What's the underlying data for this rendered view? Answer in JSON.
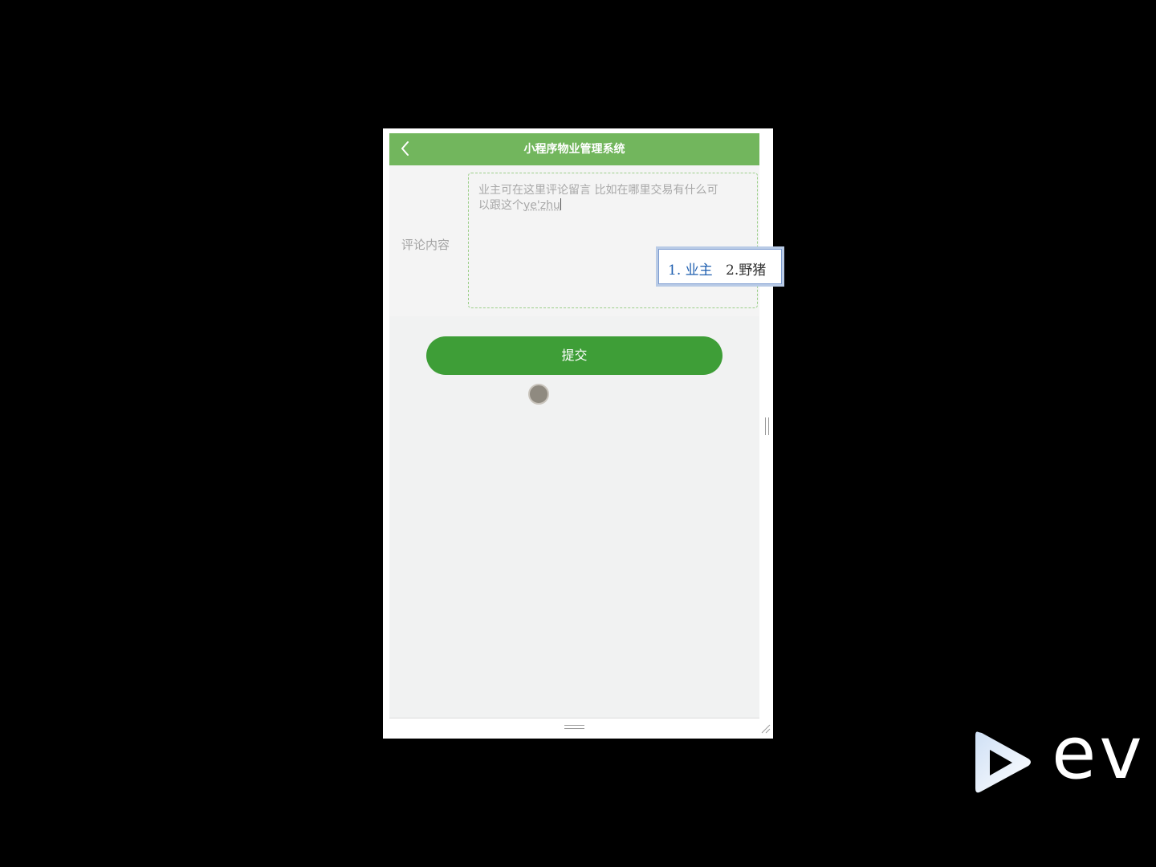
{
  "app": {
    "title": "小程序物业管理系统"
  },
  "form": {
    "label": "评论内容",
    "comment_text": "业主可在这里评论留言 比如在哪里交易有什么可以跟这个",
    "composing_text": "ye'zhu"
  },
  "submit": {
    "label": "提交"
  },
  "ime": {
    "candidates": [
      {
        "index": "1.",
        "text": "业主"
      },
      {
        "index": "2.",
        "text": "野猪"
      }
    ]
  },
  "watermark": {
    "text": "ev"
  },
  "colors": {
    "nav_bar": "#72b65d",
    "submit_button": "#3e9e37",
    "page_background": "#f1f2f2"
  },
  "icons": {
    "back": "chevron-left-icon",
    "touch_indicator": "touch-dot-icon",
    "logo": "play-logo-icon"
  }
}
